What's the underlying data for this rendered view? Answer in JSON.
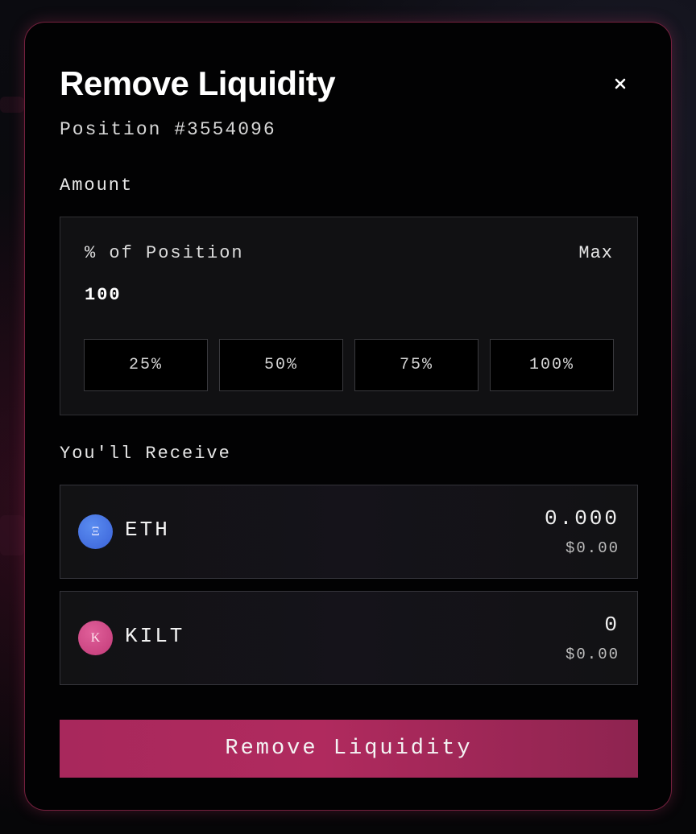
{
  "modal": {
    "title": "Remove Liquidity",
    "subtitle": "Position #3554096",
    "close_icon": "close-icon"
  },
  "amount": {
    "section_label": "Amount",
    "field_label": "% of Position",
    "max_label": "Max",
    "value": "100",
    "presets": [
      "25%",
      "50%",
      "75%",
      "100%"
    ]
  },
  "receive": {
    "section_label": "You'll Receive",
    "tokens": [
      {
        "symbol": "ETH",
        "icon_glyph": "Ξ",
        "icon": "eth-token-icon",
        "amount": "0.000",
        "usd": "$0.00",
        "color": "#3f6ae0"
      },
      {
        "symbol": "KILT",
        "icon_glyph": "K",
        "icon": "kilt-token-icon",
        "amount": "0",
        "usd": "$0.00",
        "color": "#d24683"
      }
    ]
  },
  "submit": {
    "label": "Remove Liquidity",
    "color": "#a8285c"
  },
  "theme": {
    "accent": "#d63a70",
    "background": "#020203"
  }
}
